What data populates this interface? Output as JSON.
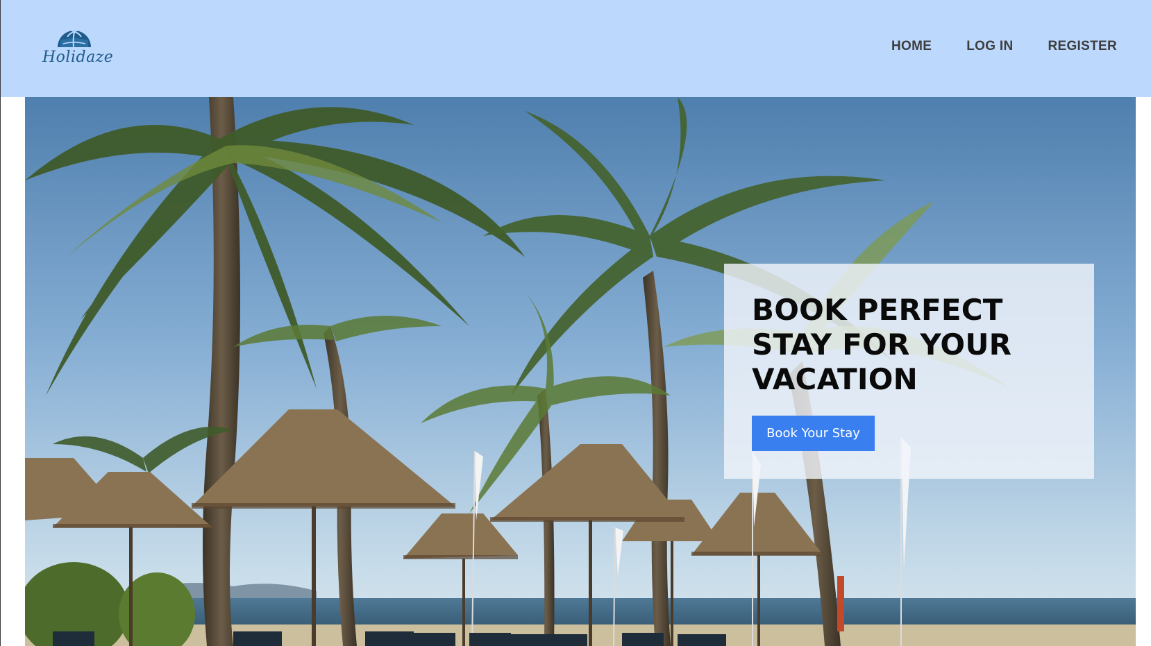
{
  "brand": {
    "name": "Holidaze",
    "logo_icon": "palm-tree-island-icon"
  },
  "nav": {
    "items": [
      {
        "label": "HOME"
      },
      {
        "label": "LOG IN"
      },
      {
        "label": "REGISTER"
      }
    ]
  },
  "hero": {
    "title": "BOOK PERFECT STAY FOR YOUR VACATION",
    "cta_label": "Book Your Stay",
    "image": "beach-palm-trees-umbrellas"
  },
  "colors": {
    "header_bg": "#bcd9fd",
    "cta_bg": "#3a7ff0",
    "nav_text": "#3d3d3d",
    "logo": "#1f5a8a"
  }
}
